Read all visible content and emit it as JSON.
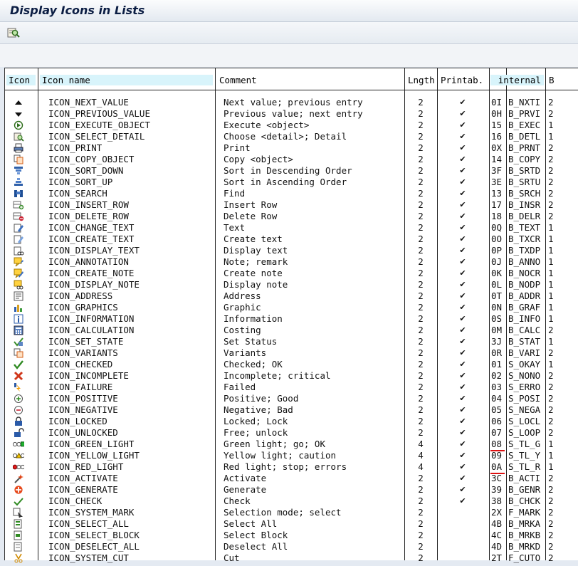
{
  "window": {
    "title": "Display Icons in Lists"
  },
  "toolbar": {
    "buttons": [
      {
        "icon": "detail-magnifier-icon"
      }
    ]
  },
  "columns": [
    "Icon",
    "Icon name",
    "Comment",
    "Lngth",
    "Printab.",
    "internal",
    "B"
  ],
  "rows": [
    {
      "icon": "up-arrow",
      "name": "ICON_NEXT_VALUE",
      "comment": "Next value; previous entry",
      "len": "2",
      "print": "✔",
      "code": "0I",
      "internal": "B_NXTI",
      "b": "2"
    },
    {
      "icon": "down-arrow",
      "name": "ICON_PREVIOUS_VALUE",
      "comment": "Previous value; next entry",
      "len": "2",
      "print": "✔",
      "code": "0H",
      "internal": "B_PRVI",
      "b": "2"
    },
    {
      "icon": "execute",
      "name": "ICON_EXECUTE_OBJECT",
      "comment": "Execute <object>",
      "len": "2",
      "print": "✔",
      "code": "15",
      "internal": "B_EXEC",
      "b": "1"
    },
    {
      "icon": "select-detail",
      "name": "ICON_SELECT_DETAIL",
      "comment": "Choose <detail>; Detail",
      "len": "2",
      "print": "✔",
      "code": "16",
      "internal": "B_DETL",
      "b": "1"
    },
    {
      "icon": "print",
      "name": "ICON_PRINT",
      "comment": "Print",
      "len": "2",
      "print": "✔",
      "code": "0X",
      "internal": "B_PRNT",
      "b": "2"
    },
    {
      "icon": "copy",
      "name": "ICON_COPY_OBJECT",
      "comment": "Copy <object>",
      "len": "2",
      "print": "✔",
      "code": "14",
      "internal": "B_COPY",
      "b": "2"
    },
    {
      "icon": "sort-down",
      "name": "ICON_SORT_DOWN",
      "comment": "Sort in Descending Order",
      "len": "2",
      "print": "✔",
      "code": "3F",
      "internal": "B_SRTD",
      "b": "2"
    },
    {
      "icon": "sort-up",
      "name": "ICON_SORT_UP",
      "comment": "Sort in Ascending Order",
      "len": "2",
      "print": "✔",
      "code": "3E",
      "internal": "B_SRTU",
      "b": "2"
    },
    {
      "icon": "search",
      "name": "ICON_SEARCH",
      "comment": "Find",
      "len": "2",
      "print": "✔",
      "code": "13",
      "internal": "B_SRCH",
      "b": "2"
    },
    {
      "icon": "insert-row",
      "name": "ICON_INSERT_ROW",
      "comment": "Insert Row",
      "len": "2",
      "print": "✔",
      "code": "17",
      "internal": "B_INSR",
      "b": "2"
    },
    {
      "icon": "delete-row",
      "name": "ICON_DELETE_ROW",
      "comment": "Delete Row",
      "len": "2",
      "print": "✔",
      "code": "18",
      "internal": "B_DELR",
      "b": "2"
    },
    {
      "icon": "change-text",
      "name": "ICON_CHANGE_TEXT",
      "comment": "Text",
      "len": "2",
      "print": "✔",
      "code": "0Q",
      "internal": "B_TEXT",
      "b": "1"
    },
    {
      "icon": "create-text",
      "name": "ICON_CREATE_TEXT",
      "comment": "Create text",
      "len": "2",
      "print": "✔",
      "code": "0O",
      "internal": "B_TXCR",
      "b": "1"
    },
    {
      "icon": "display-text",
      "name": "ICON_DISPLAY_TEXT",
      "comment": "Display text",
      "len": "2",
      "print": "✔",
      "code": "0P",
      "internal": "B_TXDP",
      "b": "1"
    },
    {
      "icon": "annotation",
      "name": "ICON_ANNOTATION",
      "comment": "Note; remark",
      "len": "2",
      "print": "✔",
      "code": "0J",
      "internal": "B_ANNO",
      "b": "1"
    },
    {
      "icon": "create-note",
      "name": "ICON_CREATE_NOTE",
      "comment": "Create note",
      "len": "2",
      "print": "✔",
      "code": "0K",
      "internal": "B_NOCR",
      "b": "1"
    },
    {
      "icon": "display-note",
      "name": "ICON_DISPLAY_NOTE",
      "comment": "Display note",
      "len": "2",
      "print": "✔",
      "code": "0L",
      "internal": "B_NODP",
      "b": "1"
    },
    {
      "icon": "address",
      "name": "ICON_ADDRESS",
      "comment": "Address",
      "len": "2",
      "print": "✔",
      "code": "0T",
      "internal": "B_ADDR",
      "b": "1"
    },
    {
      "icon": "graphics",
      "name": "ICON_GRAPHICS",
      "comment": "Graphic",
      "len": "2",
      "print": "✔",
      "code": "0N",
      "internal": "B_GRAF",
      "b": "1"
    },
    {
      "icon": "information",
      "name": "ICON_INFORMATION",
      "comment": "Information",
      "len": "2",
      "print": "✔",
      "code": "0S",
      "internal": "B_INFO",
      "b": "1"
    },
    {
      "icon": "calculation",
      "name": "ICON_CALCULATION",
      "comment": "Costing",
      "len": "2",
      "print": "✔",
      "code": "0M",
      "internal": "B_CALC",
      "b": "2"
    },
    {
      "icon": "set-state",
      "name": "ICON_SET_STATE",
      "comment": "Set Status",
      "len": "2",
      "print": "✔",
      "code": "3J",
      "internal": "B_STAT",
      "b": "1"
    },
    {
      "icon": "variants",
      "name": "ICON_VARIANTS",
      "comment": "Variants",
      "len": "2",
      "print": "✔",
      "code": "0R",
      "internal": "B_VARI",
      "b": "2"
    },
    {
      "icon": "checked",
      "name": "ICON_CHECKED",
      "comment": "Checked; OK",
      "len": "2",
      "print": "✔",
      "code": "01",
      "internal": "S_OKAY",
      "b": "1"
    },
    {
      "icon": "incomplete",
      "name": "ICON_INCOMPLETE",
      "comment": "Incomplete; critical",
      "len": "2",
      "print": "✔",
      "code": "02",
      "internal": "S_NONO",
      "b": "2"
    },
    {
      "icon": "failure",
      "name": "ICON_FAILURE",
      "comment": "Failed",
      "len": "2",
      "print": "✔",
      "code": "03",
      "internal": "S_ERRO",
      "b": "2"
    },
    {
      "icon": "positive",
      "name": "ICON_POSITIVE",
      "comment": "Positive; Good",
      "len": "2",
      "print": "✔",
      "code": "04",
      "internal": "S_POSI",
      "b": "2"
    },
    {
      "icon": "negative",
      "name": "ICON_NEGATIVE",
      "comment": "Negative; Bad",
      "len": "2",
      "print": "✔",
      "code": "05",
      "internal": "S_NEGA",
      "b": "2"
    },
    {
      "icon": "locked",
      "name": "ICON_LOCKED",
      "comment": "Locked; Lock",
      "len": "2",
      "print": "✔",
      "code": "06",
      "internal": "S_LOCL",
      "b": "2"
    },
    {
      "icon": "unlocked",
      "name": "ICON_UNLOCKED",
      "comment": "Free; unlock",
      "len": "2",
      "print": "✔",
      "code": "07",
      "internal": "S_LOOP",
      "b": "2"
    },
    {
      "icon": "green-light",
      "name": "ICON_GREEN_LIGHT",
      "comment": "Green light; go; OK",
      "len": "4",
      "print": "✔",
      "code": "08",
      "internal": "S_TL_G",
      "b": "1"
    },
    {
      "icon": "yellow-light",
      "name": "ICON_YELLOW_LIGHT",
      "comment": "Yellow light; caution",
      "len": "4",
      "print": "✔",
      "code": "09",
      "internal": "S_TL_Y",
      "b": "1"
    },
    {
      "icon": "red-light",
      "name": "ICON_RED_LIGHT",
      "comment": "Red light; stop; errors",
      "len": "4",
      "print": "✔",
      "code": "0A",
      "internal": "S_TL_R",
      "b": "1"
    },
    {
      "icon": "activate",
      "name": "ICON_ACTIVATE",
      "comment": "Activate",
      "len": "2",
      "print": "✔",
      "code": "3C",
      "internal": "B_ACTI",
      "b": "2"
    },
    {
      "icon": "generate",
      "name": "ICON_GENERATE",
      "comment": "Generate",
      "len": "2",
      "print": "✔",
      "code": "39",
      "internal": "B_GENR",
      "b": "2"
    },
    {
      "icon": "check",
      "name": "ICON_CHECK",
      "comment": "Check",
      "len": "2",
      "print": "✔",
      "code": "38",
      "internal": "B_CHCK",
      "b": "2"
    },
    {
      "icon": "system-mark",
      "name": "ICON_SYSTEM_MARK",
      "comment": "Selection mode; select",
      "len": "2",
      "print": "",
      "code": "2X",
      "internal": "F_MARK",
      "b": "2"
    },
    {
      "icon": "select-all",
      "name": "ICON_SELECT_ALL",
      "comment": "Select All",
      "len": "2",
      "print": "",
      "code": "4B",
      "internal": "B_MRKA",
      "b": "2"
    },
    {
      "icon": "select-block",
      "name": "ICON_SELECT_BLOCK",
      "comment": "Select Block",
      "len": "2",
      "print": "",
      "code": "4C",
      "internal": "B_MRKB",
      "b": "2"
    },
    {
      "icon": "deselect-all",
      "name": "ICON_DESELECT_ALL",
      "comment": "Deselect All",
      "len": "2",
      "print": "",
      "code": "4D",
      "internal": "B_MRKD",
      "b": "2"
    },
    {
      "icon": "system-cut",
      "name": "ICON_SYSTEM_CUT",
      "comment": "Cut",
      "len": "2",
      "print": "",
      "code": "2T",
      "internal": "F_CUTO",
      "b": "2"
    }
  ]
}
